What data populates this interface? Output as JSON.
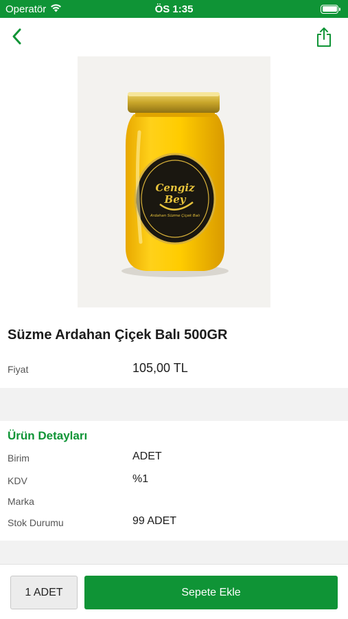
{
  "status_bar": {
    "carrier": "Operatör",
    "time": "ÖS 1:35"
  },
  "nav": {
    "back_icon": "chevron-left-icon",
    "share_icon": "share-icon",
    "accent_color": "#0f9436"
  },
  "product": {
    "image_label_line1": "Cengiz",
    "image_label_line2": "Bey",
    "image_label_subtext": "Ardahan Süzme Çiçek Balı",
    "title": "Süzme Ardahan Çiçek Balı 500GR",
    "price_label": "Fiyat",
    "price_value": "105,00 TL"
  },
  "details": {
    "title": "Ürün Detayları",
    "rows": [
      {
        "label": "Birim",
        "value": "ADET"
      },
      {
        "label": "KDV",
        "value": "%1"
      },
      {
        "label": "Marka",
        "value": ""
      },
      {
        "label": "Stok Durumu",
        "value": "99 ADET"
      }
    ]
  },
  "bottom_bar": {
    "quantity_label": "1 ADET",
    "add_to_cart_label": "Sepete Ekle"
  }
}
